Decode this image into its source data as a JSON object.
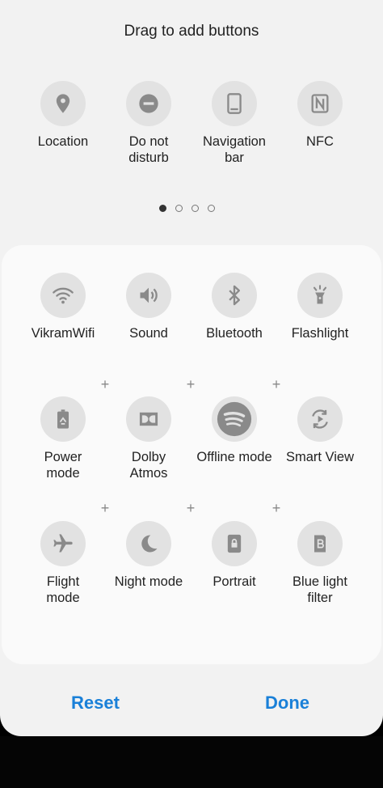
{
  "header": {
    "title": "Drag to add buttons"
  },
  "available": [
    {
      "label": "Location",
      "icon": "location-pin-icon"
    },
    {
      "label": "Do not\ndisturb",
      "icon": "do-not-disturb-icon"
    },
    {
      "label": "Navigation\nbar",
      "icon": "navigation-bar-icon"
    },
    {
      "label": "NFC",
      "icon": "nfc-icon"
    }
  ],
  "pagination": {
    "pages": 4,
    "current": 1
  },
  "active": [
    {
      "label": "VikramWifi",
      "icon": "wifi-icon"
    },
    {
      "label": "Sound",
      "icon": "speaker-icon"
    },
    {
      "label": "Bluetooth",
      "icon": "bluetooth-icon"
    },
    {
      "label": "Flashlight",
      "icon": "flashlight-icon"
    },
    {
      "label": "Power\nmode",
      "icon": "battery-recycle-icon"
    },
    {
      "label": "Dolby\nAtmos",
      "icon": "dolby-icon"
    },
    {
      "label": "Offline mode",
      "icon": "spotify-icon"
    },
    {
      "label": "Smart View",
      "icon": "smart-view-icon"
    },
    {
      "label": "Flight\nmode",
      "icon": "airplane-icon"
    },
    {
      "label": "Night mode",
      "icon": "moon-icon"
    },
    {
      "label": "Portrait",
      "icon": "portrait-lock-icon"
    },
    {
      "label": "Blue light\nfilter",
      "icon": "blue-light-filter-icon"
    }
  ],
  "plus_symbol": "+",
  "footer": {
    "reset_label": "Reset",
    "done_label": "Done"
  },
  "colors": {
    "accent": "#1a80d8",
    "icon": "#8a8a8a",
    "tile_bg": "#e2e2e2"
  }
}
